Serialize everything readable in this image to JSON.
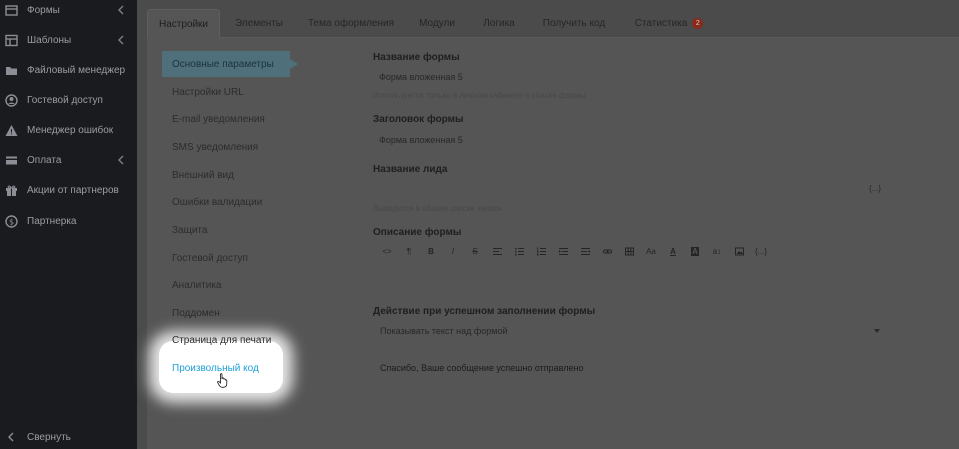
{
  "sidebar": {
    "items": [
      {
        "label": "Формы",
        "icon": "form-icon",
        "chevron": true
      },
      {
        "label": "Шаблоны",
        "icon": "template-icon",
        "chevron": true
      },
      {
        "label": "Файловый менеджер",
        "icon": "file-manager-icon",
        "chevron": false
      },
      {
        "label": "Гостевой доступ",
        "icon": "user-icon",
        "chevron": false
      },
      {
        "label": "Менеджер ошибок",
        "icon": "warning-icon",
        "chevron": false
      },
      {
        "label": "Оплата",
        "icon": "credit-card-icon",
        "chevron": true
      },
      {
        "label": "Акции от партнеров",
        "icon": "gift-icon",
        "chevron": false
      },
      {
        "label": "Партнерка",
        "icon": "dollar-icon",
        "chevron": false
      }
    ],
    "collapse_label": "Свернуть"
  },
  "tabs": [
    {
      "label": "Настройки",
      "active": true
    },
    {
      "label": "Элементы"
    },
    {
      "label": "Тема оформления"
    },
    {
      "label": "Модули"
    },
    {
      "label": "Логика"
    },
    {
      "label": "Получить код"
    },
    {
      "label": "Статистика",
      "badge": "2"
    }
  ],
  "settings_menu": [
    {
      "label": "Основные параметры",
      "active": true
    },
    {
      "label": "Настройки URL"
    },
    {
      "label": "E-mail уведомления"
    },
    {
      "label": "SMS уведомления"
    },
    {
      "label": "Внешний вид"
    },
    {
      "label": "Ошибки валидации"
    },
    {
      "label": "Защита"
    },
    {
      "label": "Гостевой доступ"
    },
    {
      "label": "Аналитика"
    },
    {
      "label": "Поддомен"
    },
    {
      "label": "Страница для печати"
    },
    {
      "label": "Произвольный код",
      "highlighted": true
    }
  ],
  "form": {
    "name_label": "Название формы",
    "name_value": "Форма вложенная 5",
    "name_hint": "Используется только в личном кабинете в списке формы",
    "heading_label": "Заголовок формы",
    "heading_value": "Форма вложенная 5",
    "lead_label": "Название лида",
    "lead_value": "",
    "lead_vars": "{...}",
    "lead_hint": "Выводится в общем списке заявок",
    "description_label": "Описание формы",
    "toolbar": [
      {
        "name": "code-view-icon",
        "glyph": "<>"
      },
      {
        "name": "paragraph-icon",
        "glyph": "¶"
      },
      {
        "name": "bold-icon",
        "glyph": "B"
      },
      {
        "name": "italic-icon",
        "glyph": "I"
      },
      {
        "name": "strikethrough-icon",
        "glyph": "S"
      },
      {
        "name": "align-icon",
        "glyph": ""
      },
      {
        "name": "unordered-list-icon",
        "glyph": ""
      },
      {
        "name": "ordered-list-icon",
        "glyph": ""
      },
      {
        "name": "outdent-icon",
        "glyph": ""
      },
      {
        "name": "indent-icon",
        "glyph": ""
      },
      {
        "name": "link-icon",
        "glyph": ""
      },
      {
        "name": "table-icon",
        "glyph": ""
      },
      {
        "name": "font-size-icon",
        "glyph": "Aa"
      },
      {
        "name": "font-color-icon",
        "glyph": "A"
      },
      {
        "name": "background-color-icon",
        "glyph": "A"
      },
      {
        "name": "line-height-icon",
        "glyph": "a↕"
      },
      {
        "name": "image-icon",
        "glyph": ""
      },
      {
        "name": "variables-icon",
        "glyph": "{...}"
      }
    ],
    "action_label": "Действие при успешном заполнении формы",
    "action_value": "Показывать текст над формой",
    "thanks_text": "Спасибо, Ваше сообщение успешно отправлено"
  },
  "colors": {
    "sidebar_bg": "#1a1b1f",
    "active_menu": "#4f6f7a",
    "highlight_link": "#1e9fd8",
    "badge": "#8a2a1a"
  }
}
